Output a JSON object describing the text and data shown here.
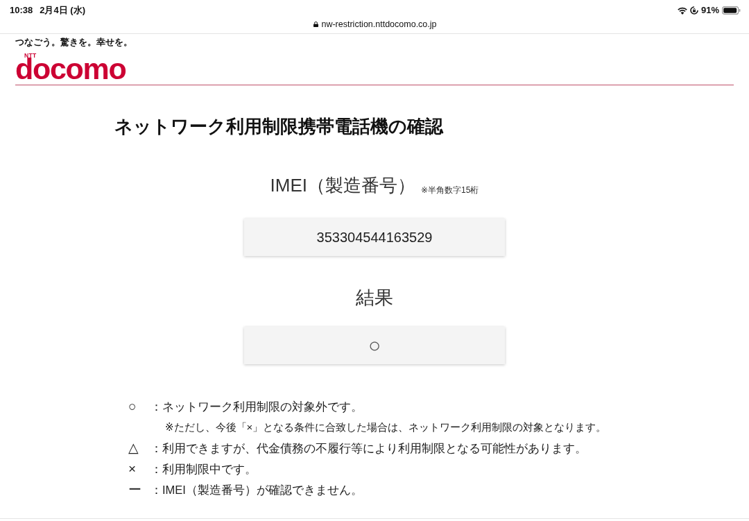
{
  "status_bar": {
    "time": "10:38",
    "date": "2月4日 (水)",
    "battery": "91%"
  },
  "address_bar": {
    "url": "nw-restriction.nttdocomo.co.jp"
  },
  "header": {
    "slogan": "つなごう。驚きを。幸せを。",
    "logo_small": "NTT",
    "logo": "docomo"
  },
  "page_title": "ネットワーク利用制限携帯電話機の確認",
  "imei_field": {
    "label": "IMEI（製造番号）",
    "note": "※半角数字15桁",
    "value": "353304544163529"
  },
  "result": {
    "label": "結果",
    "value": "○"
  },
  "legend": [
    {
      "symbol": "○",
      "separator": "：",
      "text": "ネットワーク利用制限の対象外です。",
      "note": "※ただし、今後「×」となる条件に合致した場合は、ネットワーク利用制限の対象となります。"
    },
    {
      "symbol": "△",
      "separator": "：",
      "text": "利用できますが、代金債務の不履行等により利用制限となる可能性があります。"
    },
    {
      "symbol": "×",
      "separator": "：",
      "text": "利用制限中です。"
    },
    {
      "symbol": "ー",
      "separator": "：",
      "text": "IMEI（製造番号）が確認できません。"
    }
  ]
}
